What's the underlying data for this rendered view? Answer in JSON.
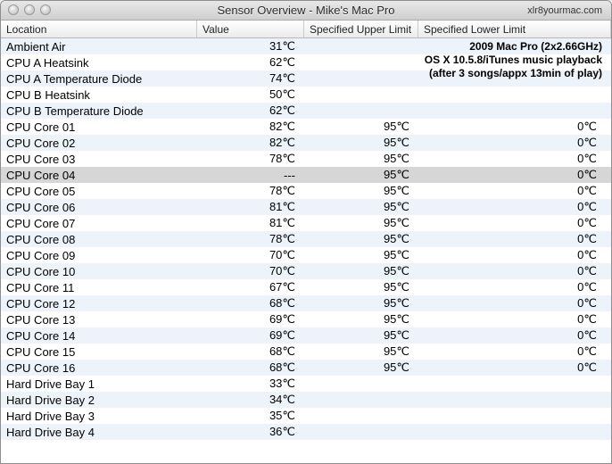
{
  "window": {
    "title": "Sensor Overview - Mike's Mac Pro",
    "brand": "xlr8yourmac.com"
  },
  "columns": {
    "location": "Location",
    "value": "Value",
    "upper": "Specified Upper Limit",
    "lower": "Specified Lower Limit"
  },
  "overlay": {
    "line1": "2009 Mac Pro (2x2.66GHz)",
    "line2": "OS X 10.5.8/iTunes music playback",
    "line3": "(after 3 songs/appx 13min of play)"
  },
  "rows": [
    {
      "location": "Ambient Air",
      "value": "31℃",
      "upper": "",
      "lower": ""
    },
    {
      "location": "CPU A Heatsink",
      "value": "62℃",
      "upper": "",
      "lower": ""
    },
    {
      "location": "CPU A Temperature Diode",
      "value": "74℃",
      "upper": "",
      "lower": ""
    },
    {
      "location": "CPU B Heatsink",
      "value": "50℃",
      "upper": "",
      "lower": ""
    },
    {
      "location": "CPU B Temperature Diode",
      "value": "62℃",
      "upper": "",
      "lower": ""
    },
    {
      "location": "CPU Core 01",
      "value": "82℃",
      "upper": "95℃",
      "lower": "0℃"
    },
    {
      "location": "CPU Core 02",
      "value": "82℃",
      "upper": "95℃",
      "lower": "0℃"
    },
    {
      "location": "CPU Core 03",
      "value": "78℃",
      "upper": "95℃",
      "lower": "0℃"
    },
    {
      "location": "CPU Core 04",
      "value": "---",
      "upper": "95℃",
      "lower": "0℃",
      "selected": true
    },
    {
      "location": "CPU Core 05",
      "value": "78℃",
      "upper": "95℃",
      "lower": "0℃"
    },
    {
      "location": "CPU Core 06",
      "value": "81℃",
      "upper": "95℃",
      "lower": "0℃"
    },
    {
      "location": "CPU Core 07",
      "value": "81℃",
      "upper": "95℃",
      "lower": "0℃"
    },
    {
      "location": "CPU Core 08",
      "value": "78℃",
      "upper": "95℃",
      "lower": "0℃"
    },
    {
      "location": "CPU Core 09",
      "value": "70℃",
      "upper": "95℃",
      "lower": "0℃"
    },
    {
      "location": "CPU Core 10",
      "value": "70℃",
      "upper": "95℃",
      "lower": "0℃"
    },
    {
      "location": "CPU Core 11",
      "value": "67℃",
      "upper": "95℃",
      "lower": "0℃"
    },
    {
      "location": "CPU Core 12",
      "value": "68℃",
      "upper": "95℃",
      "lower": "0℃"
    },
    {
      "location": "CPU Core 13",
      "value": "69℃",
      "upper": "95℃",
      "lower": "0℃"
    },
    {
      "location": "CPU Core 14",
      "value": "69℃",
      "upper": "95℃",
      "lower": "0℃"
    },
    {
      "location": "CPU Core 15",
      "value": "68℃",
      "upper": "95℃",
      "lower": "0℃"
    },
    {
      "location": "CPU Core 16",
      "value": "68℃",
      "upper": "95℃",
      "lower": "0℃"
    },
    {
      "location": "Hard Drive Bay 1",
      "value": "33℃",
      "upper": "",
      "lower": ""
    },
    {
      "location": "Hard Drive Bay 2",
      "value": "34℃",
      "upper": "",
      "lower": ""
    },
    {
      "location": "Hard Drive Bay 3",
      "value": "35℃",
      "upper": "",
      "lower": ""
    },
    {
      "location": "Hard Drive Bay 4",
      "value": "36℃",
      "upper": "",
      "lower": ""
    }
  ]
}
